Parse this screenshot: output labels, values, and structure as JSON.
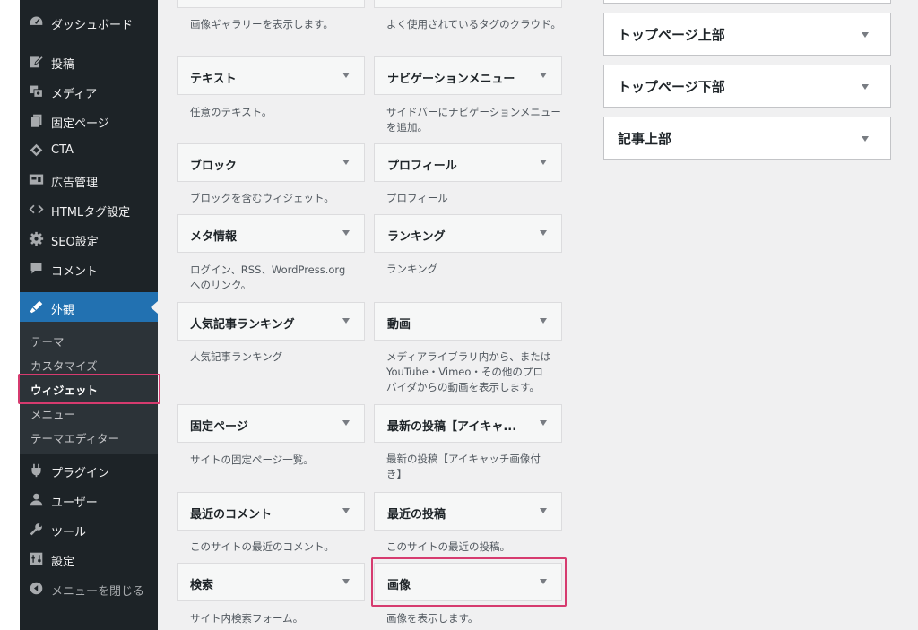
{
  "sidebar": {
    "menu": [
      {
        "label": "ダッシュボード",
        "icon": "dashboard-icon"
      },
      {
        "label": "投稿",
        "icon": "posts-icon"
      },
      {
        "label": "メディア",
        "icon": "media-icon"
      },
      {
        "label": "固定ページ",
        "icon": "pages-icon"
      },
      {
        "label": "CTA",
        "icon": "cta-icon"
      },
      {
        "label": "広告管理",
        "icon": "ad-icon"
      },
      {
        "label": "HTMLタグ設定",
        "icon": "code-icon"
      },
      {
        "label": "SEO設定",
        "icon": "seo-gear-icon"
      },
      {
        "label": "コメント",
        "icon": "comments-icon"
      },
      {
        "label": "外観",
        "icon": "appearance-icon"
      },
      {
        "label": "プラグイン",
        "icon": "plugins-icon"
      },
      {
        "label": "ユーザー",
        "icon": "users-icon"
      },
      {
        "label": "ツール",
        "icon": "tools-icon"
      },
      {
        "label": "設定",
        "icon": "settings-icon"
      },
      {
        "label": "メニューを閉じる",
        "icon": "collapse-icon"
      }
    ],
    "submenu": [
      "テーマ",
      "カスタマイズ",
      "ウィジェット",
      "メニュー",
      "テーマエディター"
    ]
  },
  "widgets": {
    "top_desc_left": "画像ギャラリーを表示します。",
    "top_desc_right": "よく使用されているタグのクラウド。",
    "items": [
      {
        "title": "テキスト",
        "desc": "任意のテキスト。"
      },
      {
        "title": "ナビゲーションメニュー",
        "desc": "サイドバーにナビゲーションメニューを追加。"
      },
      {
        "title": "ブロック",
        "desc": "ブロックを含むウィジェット。"
      },
      {
        "title": "プロフィール",
        "desc": "プロフィール"
      },
      {
        "title": "メタ情報",
        "desc": "ログイン、RSS、WordPress.org へのリンク。"
      },
      {
        "title": "ランキング",
        "desc": "ランキング"
      },
      {
        "title": "人気記事ランキング",
        "desc": "人気記事ランキング"
      },
      {
        "title": "動画",
        "desc": "メディアライブラリ内から、または YouTube・Vimeo・その他のプロバイダからの動画を表示します。"
      },
      {
        "title": "固定ページ",
        "desc": "サイトの固定ページ一覧。"
      },
      {
        "title": "最新の投稿【アイキャ...",
        "desc": "最新の投稿【アイキャッチ画像付き】"
      },
      {
        "title": "最近のコメント",
        "desc": "このサイトの最近のコメント。"
      },
      {
        "title": "最近の投稿",
        "desc": "このサイトの最近の投稿。"
      },
      {
        "title": "検索",
        "desc": "サイト内検索フォーム。"
      },
      {
        "title": "画像",
        "desc": "画像を表示します。"
      }
    ]
  },
  "areas": [
    "トップページ上部",
    "トップページ下部",
    "記事上部"
  ],
  "colors": {
    "sidebar": "#1d2327",
    "active": "#2271b1",
    "highlight": "#d63b6f",
    "content_bg": "#f0f0f1"
  }
}
